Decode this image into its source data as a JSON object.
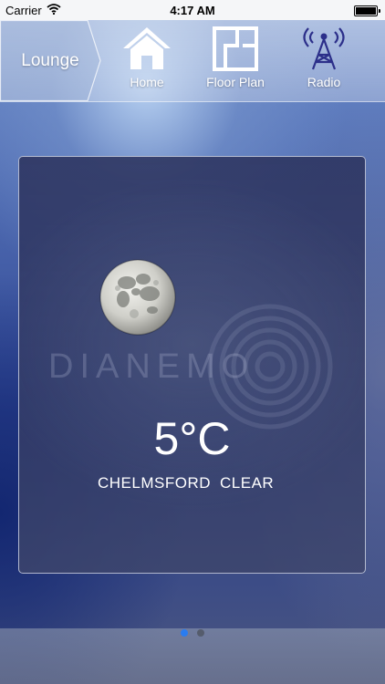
{
  "status_bar": {
    "carrier": "Carrier",
    "time": "4:17 AM"
  },
  "nav": {
    "room": "Lounge",
    "items": [
      {
        "label": "Home",
        "icon": "home-icon"
      },
      {
        "label": "Floor Plan",
        "icon": "floor-plan-icon"
      },
      {
        "label": "Radio",
        "icon": "radio-tower-icon"
      }
    ]
  },
  "weather": {
    "icon": "moon-icon",
    "brand": "DIANEMO",
    "temperature": "5°C",
    "location": "CHELMSFORD",
    "condition": "CLEAR"
  },
  "pagination": {
    "pages": 2,
    "current": 1,
    "active_color": "#2a7cf0"
  }
}
